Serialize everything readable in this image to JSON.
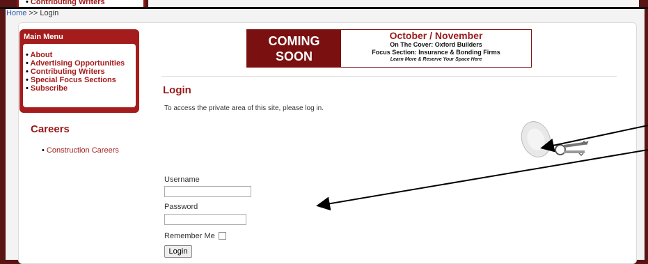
{
  "top_strip": {
    "menu_item": "Contributing Writers"
  },
  "breadcrumb": {
    "home": "Home",
    "separator": ">>",
    "current": "Login"
  },
  "main_menu": {
    "title": "Main Menu",
    "items": [
      {
        "label": "About"
      },
      {
        "label": "Advertising Opportunities"
      },
      {
        "label": "Contributing Writers"
      },
      {
        "label": "Special Focus Sections"
      },
      {
        "label": "Subscribe"
      }
    ]
  },
  "careers": {
    "title": "Careers",
    "items": [
      {
        "label": "Construction Careers"
      }
    ]
  },
  "banner": {
    "left_line1": "COMING",
    "left_line2": "SOON",
    "title": "October / November",
    "line2": "On The Cover: Oxford Builders",
    "line3": "Focus Section: Insurance & Bonding Firms",
    "line4": "Learn More & Reserve Your Space Here"
  },
  "login": {
    "title": "Login",
    "intro": "To access the private area of this site, please log in.",
    "username_label": "Username",
    "username_value": "",
    "password_label": "Password",
    "password_value": "",
    "remember_label": "Remember Me",
    "submit_label": "Login"
  },
  "icons": {
    "keys": "keys-icon",
    "annotation": "annotation-arrow-icon"
  },
  "colors": {
    "brand": "#a51c1c",
    "frame": "#5a1414",
    "link": "#2a5db0"
  }
}
